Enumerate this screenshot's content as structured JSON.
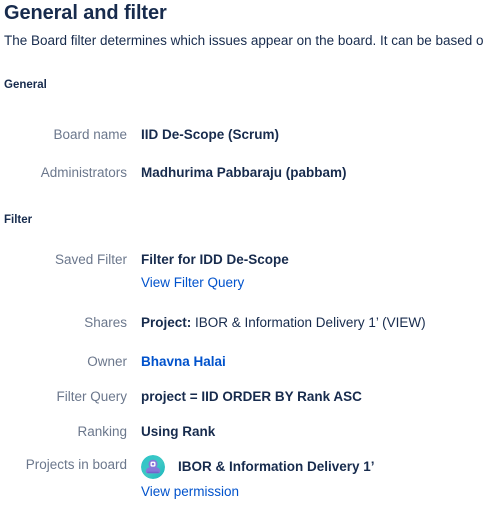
{
  "header": {
    "title": "General and filter",
    "description": "The Board filter determines which issues appear on the board. It can be based o"
  },
  "sections": {
    "general": {
      "heading": "General",
      "rows": [
        {
          "label": "Board name",
          "value": "IID De-Scope (Scrum)"
        },
        {
          "label": "Administrators",
          "value": "Madhurima Pabbaraju (pabbam)"
        }
      ]
    },
    "filter": {
      "heading": "Filter",
      "saved_filter": {
        "label": "Saved Filter",
        "value": "Filter for IDD De-Scope",
        "link": "View Filter Query"
      },
      "shares": {
        "label": "Shares",
        "value_bold": "Project:",
        "value_rest": " IBOR & Information Delivery 1’ (VIEW)"
      },
      "owner": {
        "label": "Owner",
        "value": "Bhavna Halai"
      },
      "filter_query": {
        "label": "Filter Query",
        "value": "project = IID ORDER BY Rank ASC"
      },
      "ranking": {
        "label": "Ranking",
        "value": "Using Rank"
      },
      "projects_in_board": {
        "label": "Projects in board",
        "avatar_icon": "project-avatar-icon",
        "value": "IBOR & Information Delivery 1’",
        "link": "View permission"
      }
    }
  },
  "colors": {
    "text_primary": "#172B4D",
    "text_subtle": "#6B778C",
    "link": "#0052CC",
    "background": "#FFFFFF",
    "avatar_ring": "#2BC4C9",
    "avatar_body": "#8777D9"
  }
}
